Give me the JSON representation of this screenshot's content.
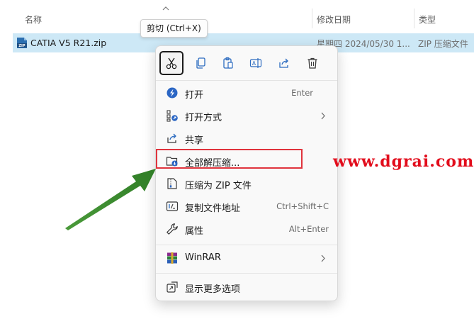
{
  "columns": {
    "name": "名称",
    "date_modified": "修改日期",
    "type": "类型"
  },
  "file": {
    "name": "CATIA V5 R21.zip",
    "date_modified": "星期四 2024/05/30 1...",
    "type": "ZIP 压缩文件",
    "icon": "zip-file-icon"
  },
  "tooltip": "剪切 (Ctrl+X)",
  "toolbar": [
    {
      "icon": "cut-icon",
      "selected": true
    },
    {
      "icon": "copy-icon"
    },
    {
      "icon": "paste-icon"
    },
    {
      "icon": "rename-icon"
    },
    {
      "icon": "share-icon"
    },
    {
      "icon": "delete-icon"
    }
  ],
  "menu": {
    "open": {
      "label": "打开",
      "shortcut": "Enter",
      "icon": "open-icon"
    },
    "open_with": {
      "label": "打开方式",
      "icon": "open-with-icon"
    },
    "share": {
      "label": "共享",
      "icon": "share-icon"
    },
    "extract_all": {
      "label": "全部解压缩...",
      "icon": "extract-folder-icon"
    },
    "compress_zip": {
      "label": "压缩为 ZIP 文件",
      "icon": "zip-compress-icon"
    },
    "copy_path": {
      "label": "复制文件地址",
      "shortcut": "Ctrl+Shift+C",
      "icon": "copy-path-icon"
    },
    "properties": {
      "label": "属性",
      "shortcut": "Alt+Enter",
      "icon": "wrench-icon"
    },
    "winrar": {
      "label": "WinRAR",
      "icon": "winrar-icon"
    },
    "more_options": {
      "label": "显示更多选项",
      "icon": "more-options-icon"
    }
  },
  "watermark": "www.dgrai.com",
  "colors": {
    "selection": "#cde8f6",
    "highlight": "#e0343d",
    "arrow": "#3a8a2c",
    "watermark": "#e20d1c"
  }
}
